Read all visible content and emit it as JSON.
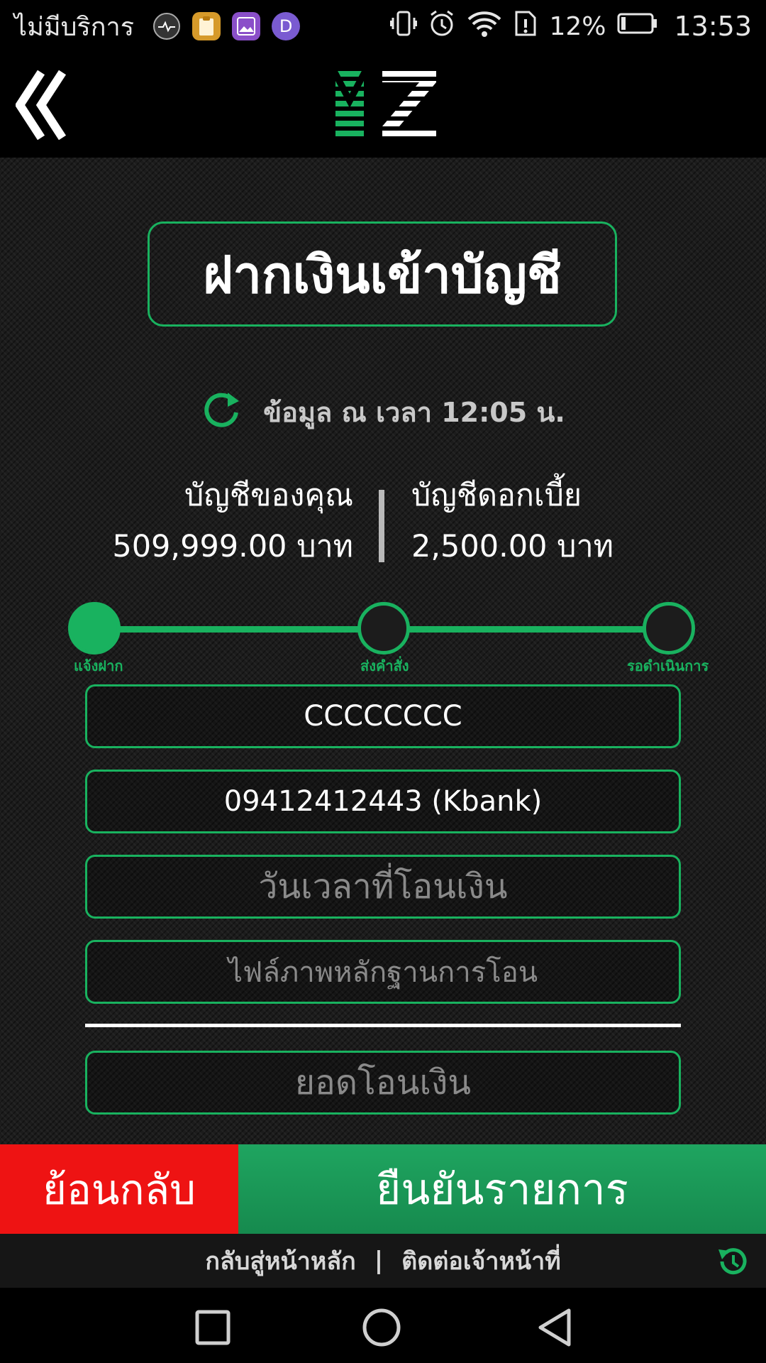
{
  "status_bar": {
    "carrier": "ไม่มีบริการ",
    "app_icons": [
      "health-icon",
      "clipboard-icon",
      "gallery-icon",
      "d-app-icon"
    ],
    "d_letter": "D",
    "battery_pct": "12%",
    "time": "13:53"
  },
  "header": {
    "logo_text": "MZ"
  },
  "page": {
    "title": "ฝากเงินเข้าบัญชี",
    "refresh_text": "ข้อมูล ณ เวลา 12:05 น."
  },
  "accounts": {
    "yours_label": "บัญชีของคุณ",
    "yours_value": "509,999.00 บาท",
    "interest_label": "บัญชีดอกเบี้ย",
    "interest_value": "2,500.00 บาท"
  },
  "stepper": {
    "steps": [
      "แจ้งฝาก",
      "ส่งคำสั่ง",
      "รอดำเนินการ"
    ],
    "active_index": 0
  },
  "form": {
    "name_value": "CCCCCCCC",
    "account_value": "09412412443 (Kbank)",
    "datetime_placeholder": "วันเวลาที่โอนเงิน",
    "file_placeholder": "ไฟล์ภาพหลักฐานการโอน",
    "amount_placeholder": "ยอดโอนเงิน"
  },
  "actions": {
    "back_label": "ย้อนกลับ",
    "confirm_label": "ยืนยันรายการ"
  },
  "footer": {
    "home_link": "กลับสู่หน้าหลัก",
    "separator": "|",
    "contact_link": "ติดต่อเจ้าหน้าที่"
  },
  "colors": {
    "accent_green": "#19b25f",
    "back_red": "#ee1313",
    "confirm_green": "#1fa560"
  }
}
